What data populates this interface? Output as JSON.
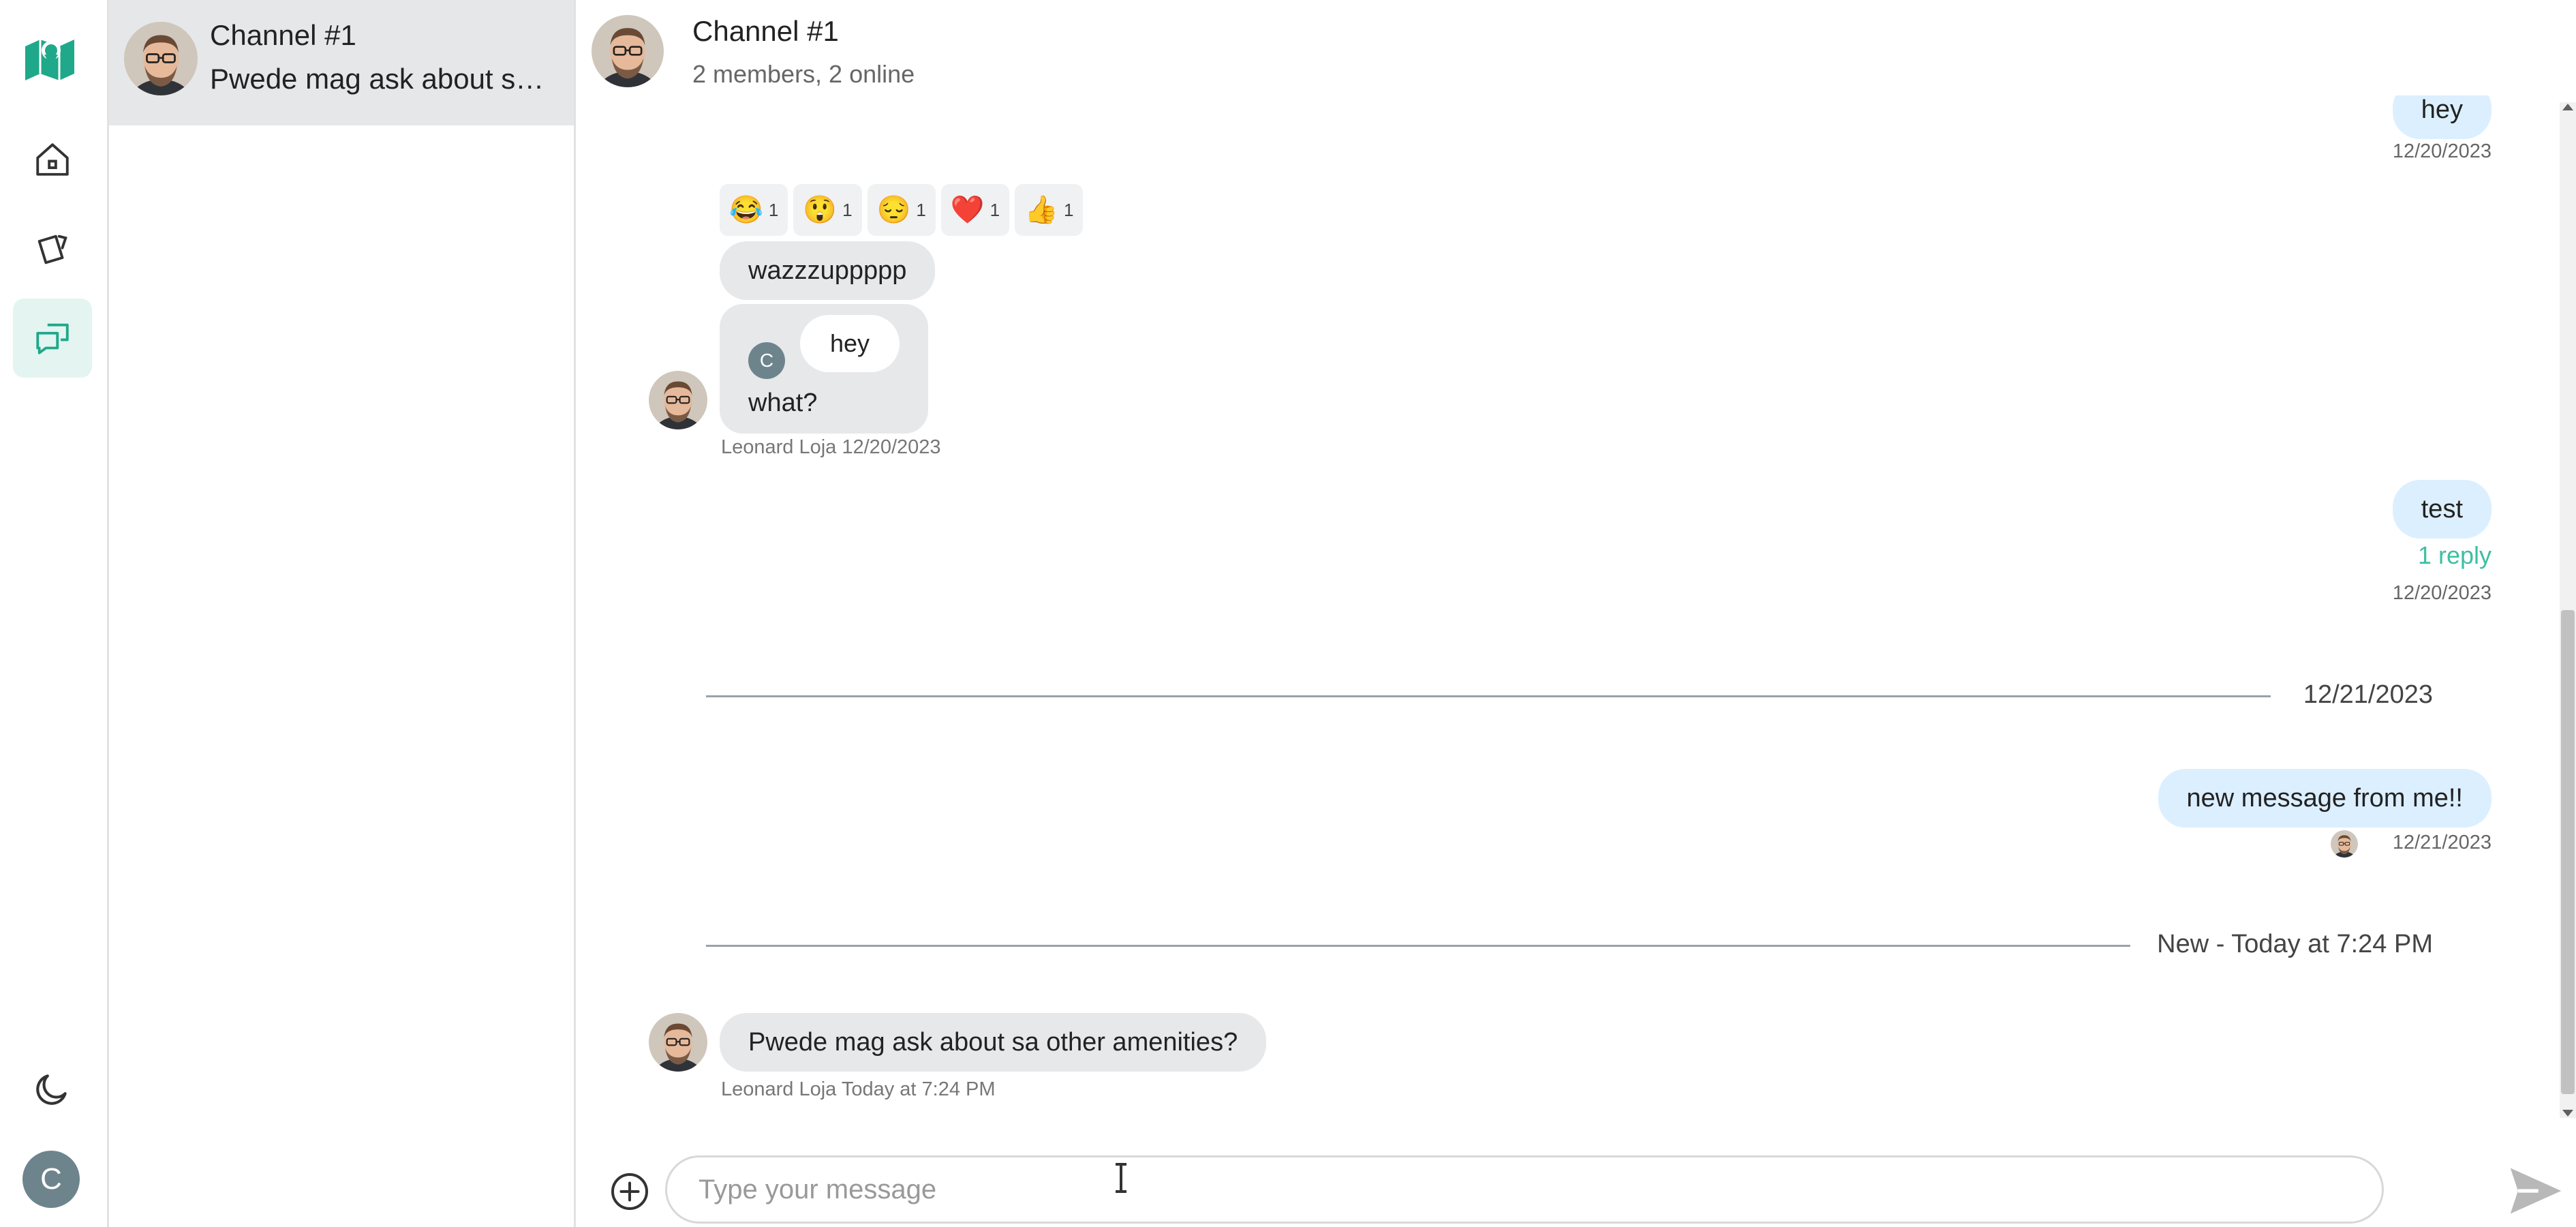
{
  "sidebar": {
    "nav": [
      {
        "icon": "home-icon"
      },
      {
        "icon": "bookings-icon"
      },
      {
        "icon": "chat-icon",
        "active": true
      }
    ],
    "avatar_letter": "C"
  },
  "channel_list": {
    "items": [
      {
        "name": "Channel #1",
        "preview": "Pwede mag ask about sa other amenities?"
      }
    ]
  },
  "header": {
    "title": "Channel #1",
    "subtitle": "2 members, 2 online"
  },
  "messages": {
    "m1": {
      "text": "hey",
      "date": "12/20/2023"
    },
    "reactions": [
      {
        "emoji": "😂",
        "count": "1"
      },
      {
        "emoji": "😲",
        "count": "1"
      },
      {
        "emoji": "😔",
        "count": "1"
      },
      {
        "emoji": "❤️",
        "count": "1"
      },
      {
        "emoji": "👍",
        "count": "1"
      }
    ],
    "m2": {
      "text": "wazzzuppppp"
    },
    "m3": {
      "quote_initial": "C",
      "quote_text": "hey",
      "text": "what?"
    },
    "m3_meta": "Leonard Loja 12/20/2023",
    "m4": {
      "text": "test",
      "reply_link": "1 reply",
      "date": "12/20/2023"
    },
    "divider1": "12/21/2023",
    "m5": {
      "text": "new message from me!!",
      "date": "12/21/2023"
    },
    "divider2": "New - Today at 7:24 PM",
    "m6": {
      "text": "Pwede mag ask about sa other amenities?",
      "meta": "Leonard Loja Today at 7:24 PM"
    }
  },
  "composer": {
    "placeholder": "Type your message"
  },
  "colors": {
    "accent": "#1fa88a",
    "outgoing_bubble": "#dcefff",
    "incoming_bubble": "#e7e8ea",
    "active_nav_bg": "#e4f5f1"
  }
}
